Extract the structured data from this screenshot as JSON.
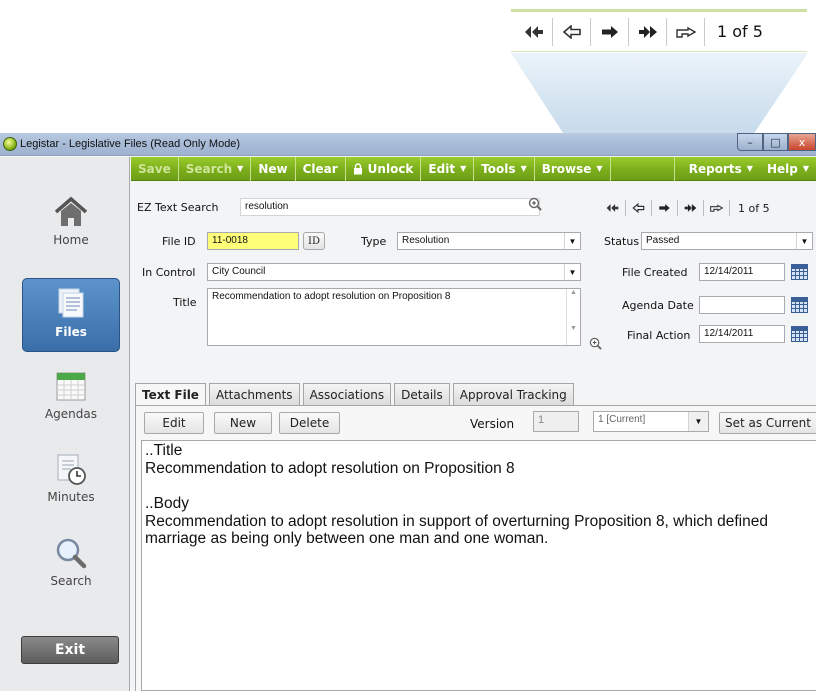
{
  "window": {
    "title": "Legistar - Legislative Files (Read Only Mode)",
    "controls": {
      "minimize": "–",
      "maximize": "□",
      "close": "x"
    }
  },
  "zoom_callout": {
    "pager_text": "1 of 5",
    "buttons": [
      "first-icon",
      "previous-icon",
      "next-icon",
      "last-icon",
      "go-to-icon"
    ]
  },
  "toolbar": {
    "items": [
      {
        "label": "Save",
        "enabled": false,
        "dropdown": false
      },
      {
        "label": "Search",
        "enabled": false,
        "dropdown": true
      },
      {
        "label": "New",
        "enabled": true,
        "dropdown": false
      },
      {
        "label": "Clear",
        "enabled": true,
        "dropdown": false
      },
      {
        "label": "Unlock",
        "enabled": true,
        "dropdown": false,
        "icon": "lock-icon"
      },
      {
        "label": "Edit",
        "enabled": true,
        "dropdown": true
      },
      {
        "label": "Tools",
        "enabled": true,
        "dropdown": true
      },
      {
        "label": "Browse",
        "enabled": true,
        "dropdown": true
      },
      {
        "label": "Reports",
        "enabled": true,
        "dropdown": true
      },
      {
        "label": "Help",
        "enabled": true,
        "dropdown": true
      }
    ]
  },
  "sidebar": {
    "items": [
      {
        "label": "Home",
        "icon": "home-icon",
        "active": false
      },
      {
        "label": "Files",
        "icon": "files-icon",
        "active": true
      },
      {
        "label": "Agendas",
        "icon": "calendar-icon",
        "active": false
      },
      {
        "label": "Minutes",
        "icon": "minutes-icon",
        "active": false
      },
      {
        "label": "Search",
        "icon": "magnifier-icon",
        "active": false
      }
    ],
    "exit_label": "Exit"
  },
  "form": {
    "ez_search_label": "EZ Text Search",
    "ez_search_value": "resolution",
    "pager_text": "1 of 5",
    "file_id_label": "File ID",
    "file_id_value": "11-0018",
    "id_button": "ID",
    "type_label": "Type",
    "type_value": "Resolution",
    "status_label": "Status",
    "status_value": "Passed",
    "in_control_label": "In Control",
    "in_control_value": "City Council",
    "file_created_label": "File Created",
    "file_created_value": "12/14/2011",
    "title_label": "Title",
    "title_value": "Recommendation to adopt resolution on Proposition 8",
    "agenda_date_label": "Agenda Date",
    "agenda_date_value": "",
    "final_action_label": "Final Action",
    "final_action_value": "12/14/2011"
  },
  "tabs": [
    "Text File",
    "Attachments",
    "Associations",
    "Details",
    "Approval Tracking"
  ],
  "text_file": {
    "edit_button": "Edit",
    "new_button": "New",
    "delete_button": "Delete",
    "version_label": "Version",
    "version_value": "1",
    "version_select_value": "1 [Current]",
    "set_current_button": "Set as Current",
    "title_heading": "..Title",
    "title_body": "Recommendation to adopt resolution on Proposition 8",
    "body_heading": "..Body",
    "body_text": "Recommendation to adopt resolution in support of overturning Proposition 8, which defined marriage as being only between one man and one woman."
  },
  "colors": {
    "toolbar_green": "#7cae1c",
    "active_nav_blue": "#3a6ea9",
    "file_id_highlight": "#ffff7a",
    "callout_beam": "#b8d2e6"
  }
}
